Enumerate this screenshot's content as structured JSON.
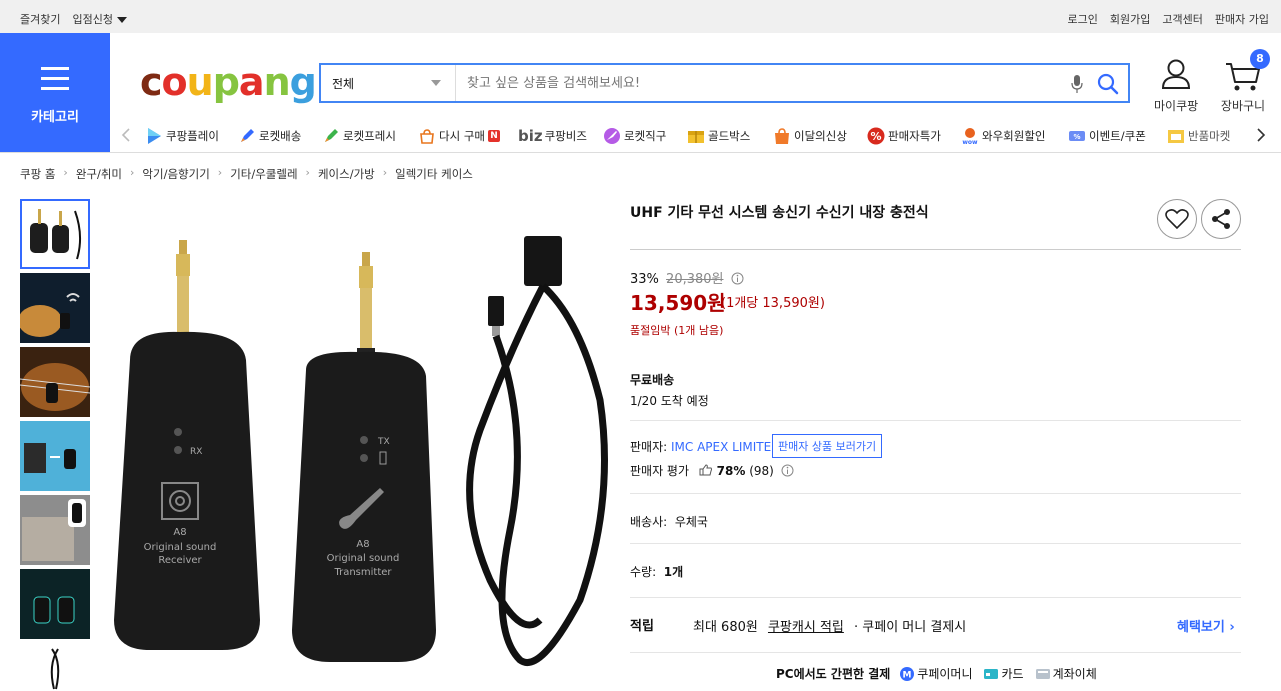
{
  "topbar": {
    "favorites": "즐겨찾기",
    "store_apply": "입점신청",
    "login": "로그인",
    "signup": "회원가입",
    "customer_center": "고객센터",
    "seller_signup": "판매자 가입"
  },
  "header": {
    "category_label": "카테고리",
    "logo": "coupang",
    "search_category": "전체",
    "search_placeholder": "찾고 싶은 상품을 검색해보세요!",
    "my_coupang": "마이쿠팡",
    "cart": "장바구니",
    "cart_count": "8"
  },
  "subnav": [
    "쿠팡플레이",
    "로켓배송",
    "로켓프레시",
    "다시 구매",
    "쿠팡비즈",
    "로켓직구",
    "골드박스",
    "이달의신상",
    "판매자특가",
    "와우회원할인",
    "이벤트/쿠폰",
    "반품마켓"
  ],
  "subnav_biz_prefix": "biz",
  "breadcrumb": [
    "쿠팡 홈",
    "완구/취미",
    "악기/음향기기",
    "기타/우쿨렐레",
    "케이스/가방",
    "일렉기타 케이스"
  ],
  "product": {
    "title": "UHF 기타 무선 시스템 송신기 수신기 내장 충전식",
    "discount_rate": "33%",
    "original_price": "20,380원",
    "price": "13,590원",
    "unit_price": "(1개당 13,590원)",
    "stock_note": "품절임박 (1개 남음)",
    "shipping_label": "무료배송",
    "arrival": "1/20 도착 예정",
    "seller_label": "판매자:",
    "seller_name": "IMC APEX LIMITED",
    "seller_button": "판매자 상품 보러가기",
    "rating_label": "판매자 평가",
    "rating_value": "78%",
    "rating_count": "(98)",
    "carrier_label": "배송사:",
    "carrier": "우체국",
    "qty_label": "수량:",
    "qty": "1개",
    "reward_label": "적립",
    "reward_max": "최대 680원",
    "reward_link": "쿠팡캐시 적립",
    "reward_note": "· 쿠페이 머니 결제시",
    "benefit_link": "혜택보기 ›",
    "pay_title": "PC에서도 간편한 결제",
    "pay_money": "쿠페이머니",
    "pay_card": "카드",
    "pay_bank": "계좌이체"
  },
  "image_text": {
    "rx_label": "RX",
    "tx_label": "TX",
    "receiver_line1": "A8",
    "receiver_line2": "Original sound",
    "receiver_line3": "Receiver",
    "transmitter_line1": "A8",
    "transmitter_line2": "Original sound",
    "transmitter_line3": "Transmitter"
  },
  "colors": {
    "brand_blue": "#346aff",
    "price_red": "#ae0000"
  }
}
